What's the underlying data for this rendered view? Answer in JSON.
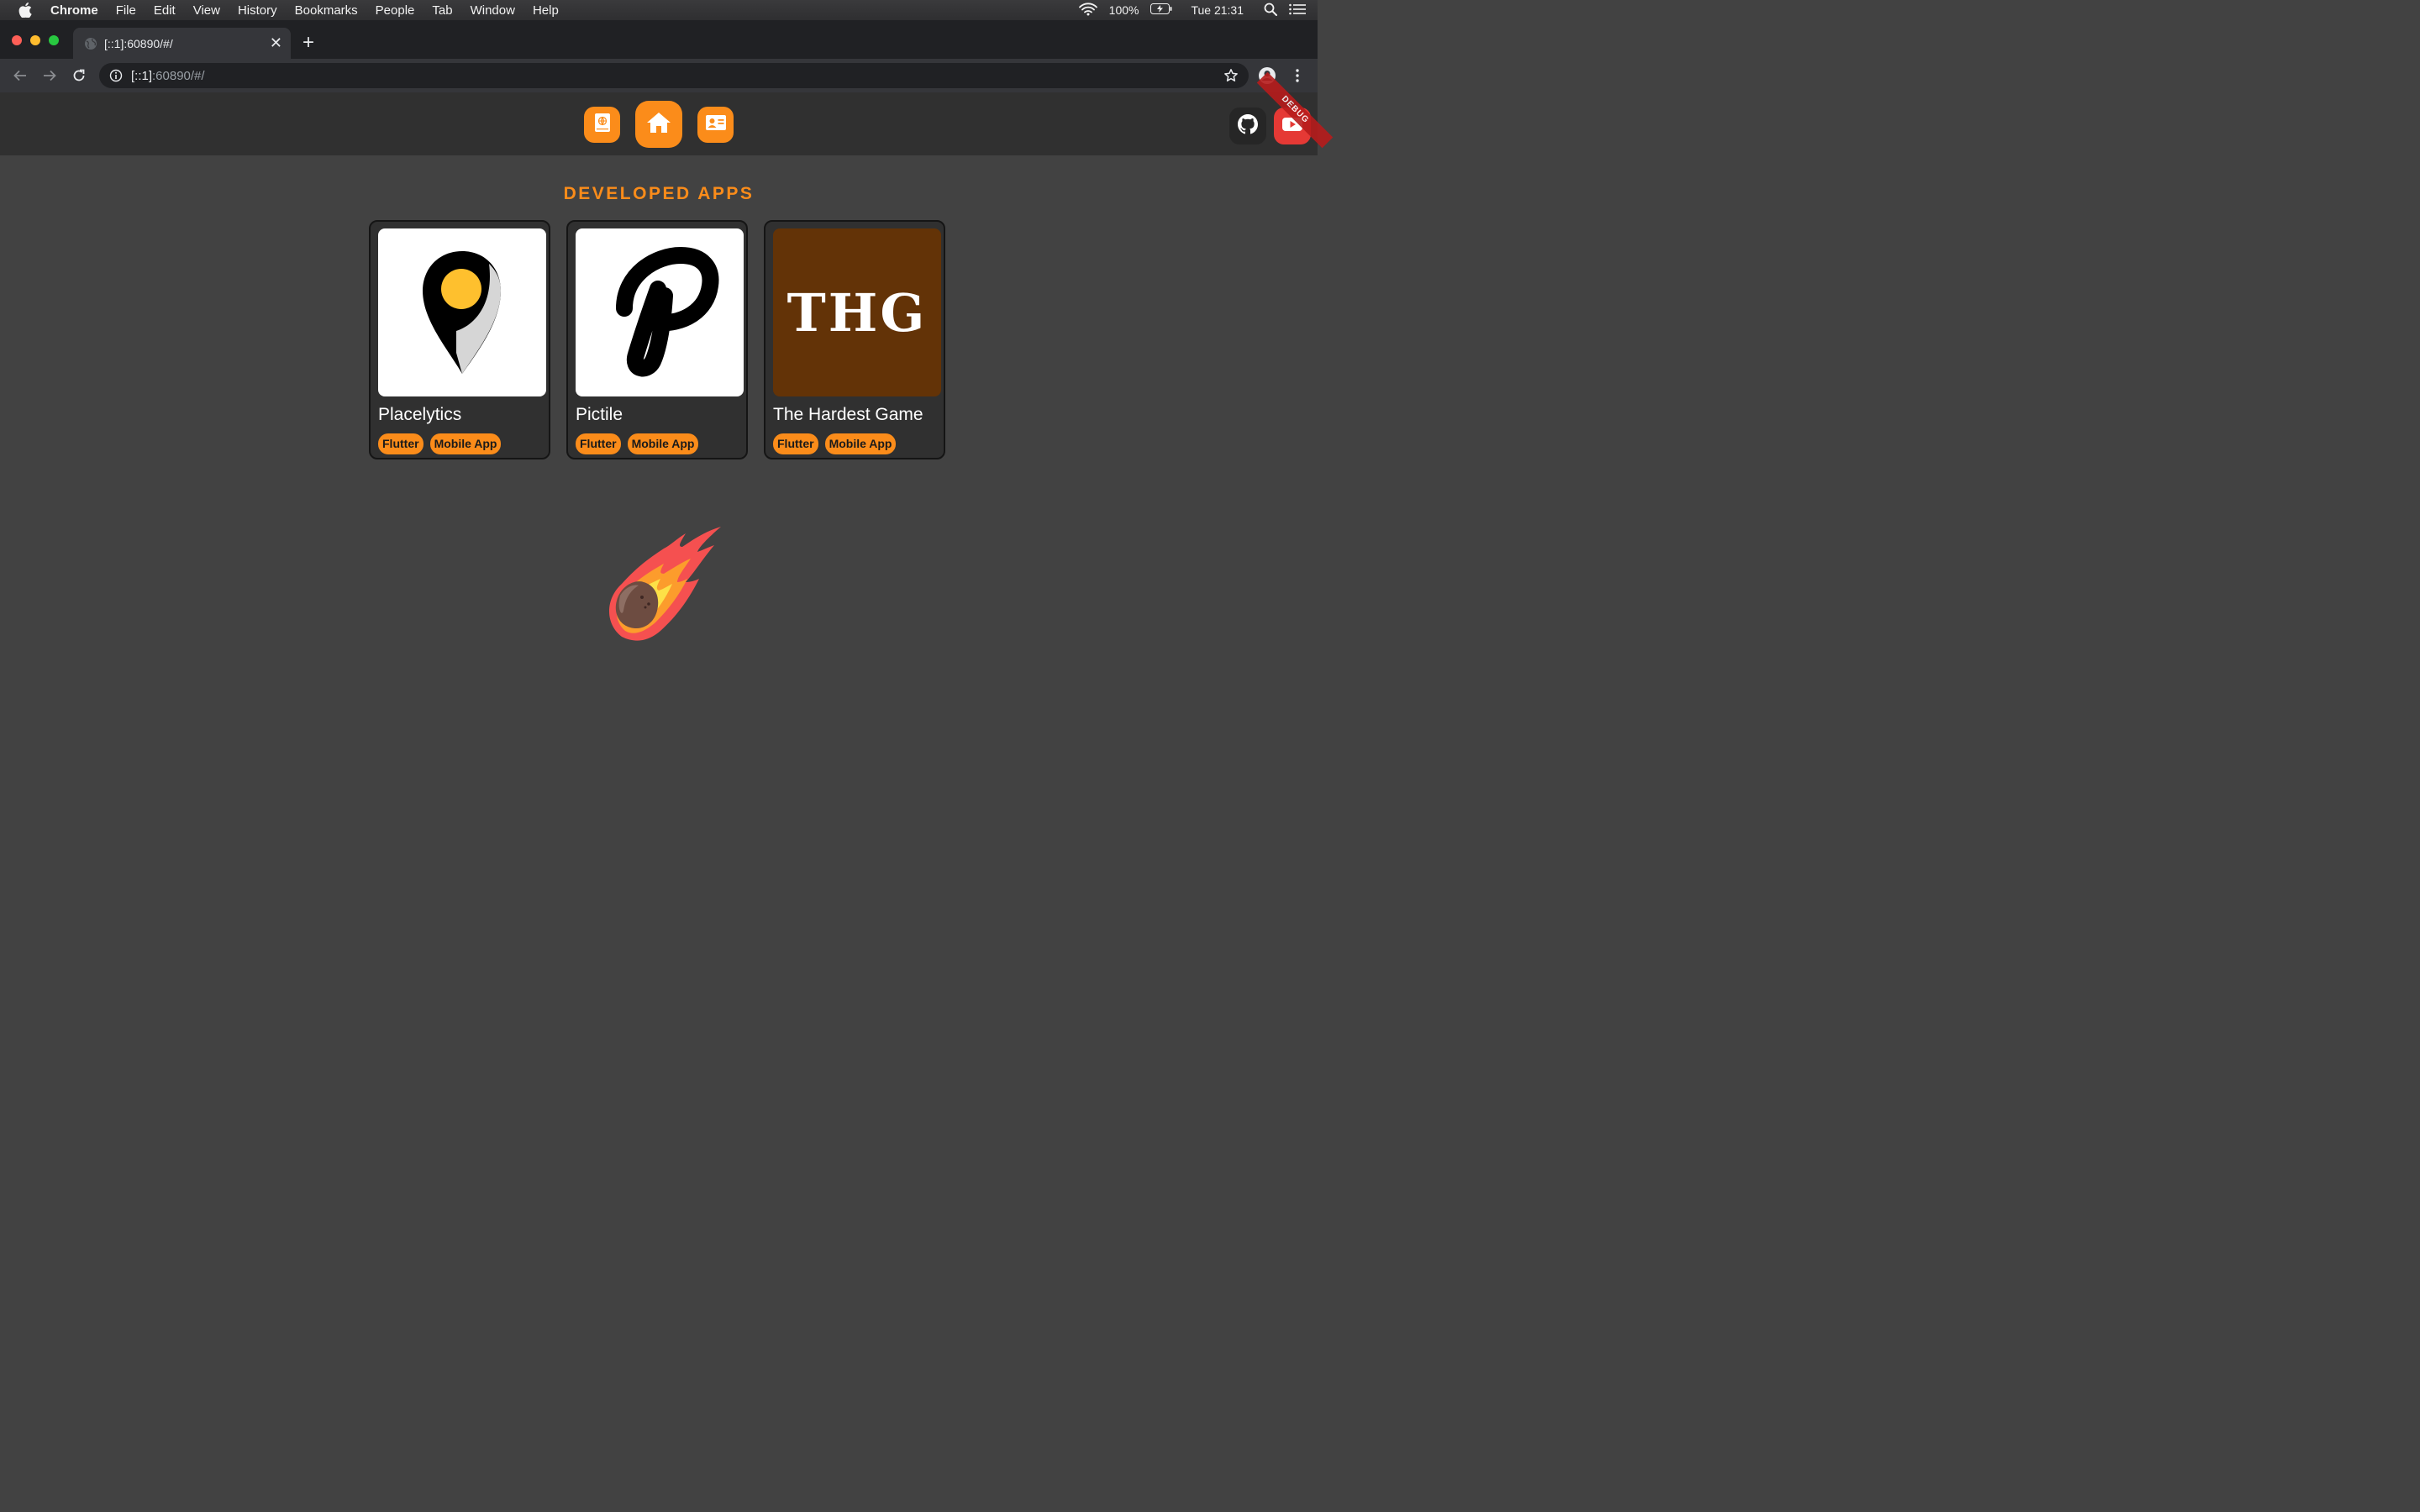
{
  "menubar": {
    "items": [
      "Chrome",
      "File",
      "Edit",
      "View",
      "History",
      "Bookmarks",
      "People",
      "Tab",
      "Window",
      "Help"
    ],
    "battery": "100%",
    "clock": "Tue 21:31"
  },
  "browser": {
    "tab_title": "[::1]:60890/#/",
    "url_host": "[::1]",
    "url_rest": ":60890/#/"
  },
  "app": {
    "nav": [
      "about-icon",
      "home-icon",
      "contact-card-icon"
    ],
    "social": [
      "github-icon",
      "youtube-icon"
    ],
    "debug_banner": "DEBUG",
    "section_title": "DEVELOPED APPS",
    "apps": [
      {
        "name": "Placelytics",
        "tags": [
          "Flutter",
          "Mobile App"
        ]
      },
      {
        "name": "Pictile",
        "tags": [
          "Flutter",
          "Mobile App"
        ]
      },
      {
        "name": "The Hardest Game",
        "logo_text": "THG",
        "tags": [
          "Flutter",
          "Mobile App"
        ]
      }
    ],
    "colors": {
      "accent": "#fb8c1a",
      "background": "#424242",
      "appbar": "#303030",
      "thg_bg": "#633307"
    }
  }
}
